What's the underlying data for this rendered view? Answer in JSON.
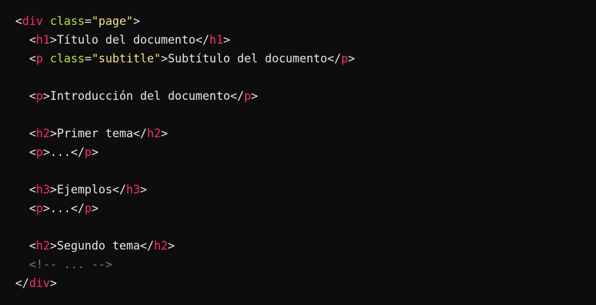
{
  "code": {
    "lines": [
      [
        {
          "t": "<",
          "c": "punct"
        },
        {
          "t": "div",
          "c": "tag"
        },
        {
          "t": " ",
          "c": "text"
        },
        {
          "t": "class",
          "c": "attr"
        },
        {
          "t": "=",
          "c": "punct"
        },
        {
          "t": "\"page\"",
          "c": "str"
        },
        {
          "t": ">",
          "c": "punct"
        }
      ],
      [
        {
          "t": "  <",
          "c": "punct"
        },
        {
          "t": "h1",
          "c": "tag"
        },
        {
          "t": ">",
          "c": "punct"
        },
        {
          "t": "Título del documento",
          "c": "text"
        },
        {
          "t": "</",
          "c": "punct"
        },
        {
          "t": "h1",
          "c": "tag"
        },
        {
          "t": ">",
          "c": "punct"
        }
      ],
      [
        {
          "t": "  <",
          "c": "punct"
        },
        {
          "t": "p",
          "c": "tag"
        },
        {
          "t": " ",
          "c": "text"
        },
        {
          "t": "class",
          "c": "attr"
        },
        {
          "t": "=",
          "c": "punct"
        },
        {
          "t": "\"subtitle\"",
          "c": "str"
        },
        {
          "t": ">",
          "c": "punct"
        },
        {
          "t": "Subtítulo del documento",
          "c": "text"
        },
        {
          "t": "</",
          "c": "punct"
        },
        {
          "t": "p",
          "c": "tag"
        },
        {
          "t": ">",
          "c": "punct"
        }
      ],
      [],
      [
        {
          "t": "  <",
          "c": "punct"
        },
        {
          "t": "p",
          "c": "tag"
        },
        {
          "t": ">",
          "c": "punct"
        },
        {
          "t": "Introducción del documento",
          "c": "text"
        },
        {
          "t": "</",
          "c": "punct"
        },
        {
          "t": "p",
          "c": "tag"
        },
        {
          "t": ">",
          "c": "punct"
        }
      ],
      [],
      [
        {
          "t": "  <",
          "c": "punct"
        },
        {
          "t": "h2",
          "c": "tag"
        },
        {
          "t": ">",
          "c": "punct"
        },
        {
          "t": "Primer tema",
          "c": "text"
        },
        {
          "t": "</",
          "c": "punct"
        },
        {
          "t": "h2",
          "c": "tag"
        },
        {
          "t": ">",
          "c": "punct"
        }
      ],
      [
        {
          "t": "  <",
          "c": "punct"
        },
        {
          "t": "p",
          "c": "tag"
        },
        {
          "t": ">",
          "c": "punct"
        },
        {
          "t": "...",
          "c": "text"
        },
        {
          "t": "</",
          "c": "punct"
        },
        {
          "t": "p",
          "c": "tag"
        },
        {
          "t": ">",
          "c": "punct"
        }
      ],
      [],
      [
        {
          "t": "  <",
          "c": "punct"
        },
        {
          "t": "h3",
          "c": "tag"
        },
        {
          "t": ">",
          "c": "punct"
        },
        {
          "t": "Ejemplos",
          "c": "text"
        },
        {
          "t": "</",
          "c": "punct"
        },
        {
          "t": "h3",
          "c": "tag"
        },
        {
          "t": ">",
          "c": "punct"
        }
      ],
      [
        {
          "t": "  <",
          "c": "punct"
        },
        {
          "t": "p",
          "c": "tag"
        },
        {
          "t": ">",
          "c": "punct"
        },
        {
          "t": "...",
          "c": "text"
        },
        {
          "t": "</",
          "c": "punct"
        },
        {
          "t": "p",
          "c": "tag"
        },
        {
          "t": ">",
          "c": "punct"
        }
      ],
      [],
      [
        {
          "t": "  <",
          "c": "punct"
        },
        {
          "t": "h2",
          "c": "tag"
        },
        {
          "t": ">",
          "c": "punct"
        },
        {
          "t": "Segundo tema",
          "c": "text"
        },
        {
          "t": "</",
          "c": "punct"
        },
        {
          "t": "h2",
          "c": "tag"
        },
        {
          "t": ">",
          "c": "punct"
        }
      ],
      [
        {
          "t": "  <!-- ... -->",
          "c": "comment"
        }
      ],
      [
        {
          "t": "</",
          "c": "punct"
        },
        {
          "t": "div",
          "c": "tag"
        },
        {
          "t": ">",
          "c": "punct"
        }
      ]
    ]
  },
  "theme": {
    "background": "#0d0d0d",
    "tag": "#ff2f66",
    "attribute": "#b5e045",
    "string": "#f7e08a",
    "text": "#e8e8e8",
    "comment": "#6b7b8c"
  }
}
